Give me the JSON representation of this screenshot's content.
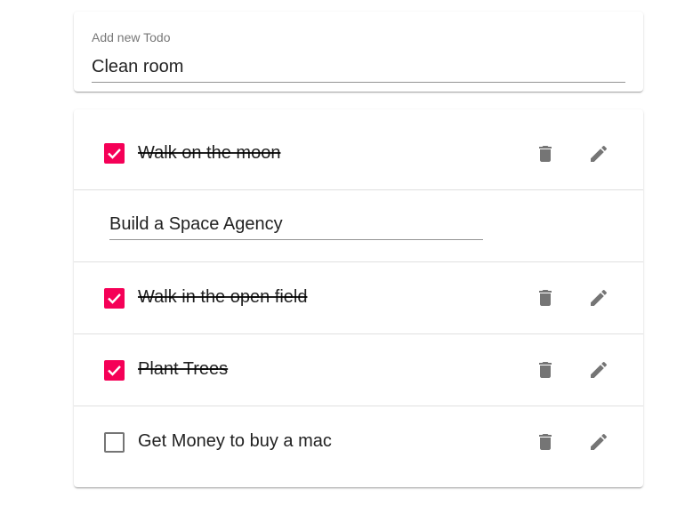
{
  "add_todo": {
    "label": "Add new Todo",
    "value": "Clean room"
  },
  "todos": [
    {
      "text": "Walk on the moon",
      "completed": true
    },
    {
      "text": "Build a Space Agency",
      "editing": true
    },
    {
      "text": "Walk in the open field",
      "completed": true
    },
    {
      "text": "Plant Trees",
      "completed": true
    },
    {
      "text": "Get Money to buy a mac",
      "completed": false
    }
  ],
  "icons": {
    "delete": "trash-icon",
    "edit": "pencil-icon",
    "check": "check-icon"
  },
  "colors": {
    "checked": "#f50057",
    "icon": "#757575"
  }
}
